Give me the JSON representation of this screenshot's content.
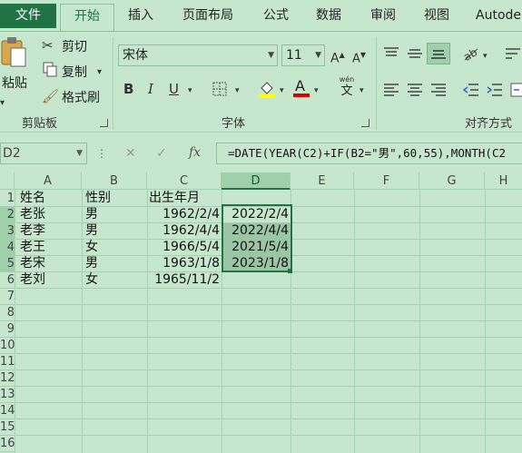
{
  "tabs": [
    "文件",
    "开始",
    "插入",
    "页面布局",
    "公式",
    "数据",
    "审阅",
    "视图",
    "Autode"
  ],
  "clipboard": {
    "paste_label": "粘贴",
    "cut_label": "剪切",
    "copy_label": "复制",
    "format_painter_label": "格式刷",
    "group_label": "剪贴板"
  },
  "font": {
    "name": "宋体",
    "size": "11",
    "group_label": "字体",
    "bold": "B",
    "italic": "I",
    "underline": "U",
    "wen_label": "wén",
    "wen_char": "文"
  },
  "alignment": {
    "group_label": "对齐方式"
  },
  "formula_bar": {
    "name_box": "D2",
    "formula": "=DATE(YEAR(C2)+IF(B2=\"男\",60,55),MONTH(C2"
  },
  "columns": [
    "A",
    "B",
    "C",
    "D",
    "E",
    "F",
    "G",
    "H"
  ],
  "selected_column": "D",
  "rows": [
    "1",
    "2",
    "3",
    "4",
    "5",
    "6",
    "7",
    "8",
    "9",
    "10",
    "11",
    "12",
    "13",
    "14",
    "15",
    "16"
  ],
  "table": [
    [
      "姓名",
      "性别",
      "出生年月",
      ""
    ],
    [
      "老张",
      "男",
      "1962/2/4",
      "2022/2/4"
    ],
    [
      "老李",
      "男",
      "1962/4/4",
      "2022/4/4"
    ],
    [
      "老王",
      "女",
      "1966/5/4",
      "2021/5/4"
    ],
    [
      "老宋",
      "男",
      "1963/1/8",
      "2023/1/8"
    ],
    [
      "老刘",
      "女",
      "1965/11/2",
      ""
    ]
  ]
}
